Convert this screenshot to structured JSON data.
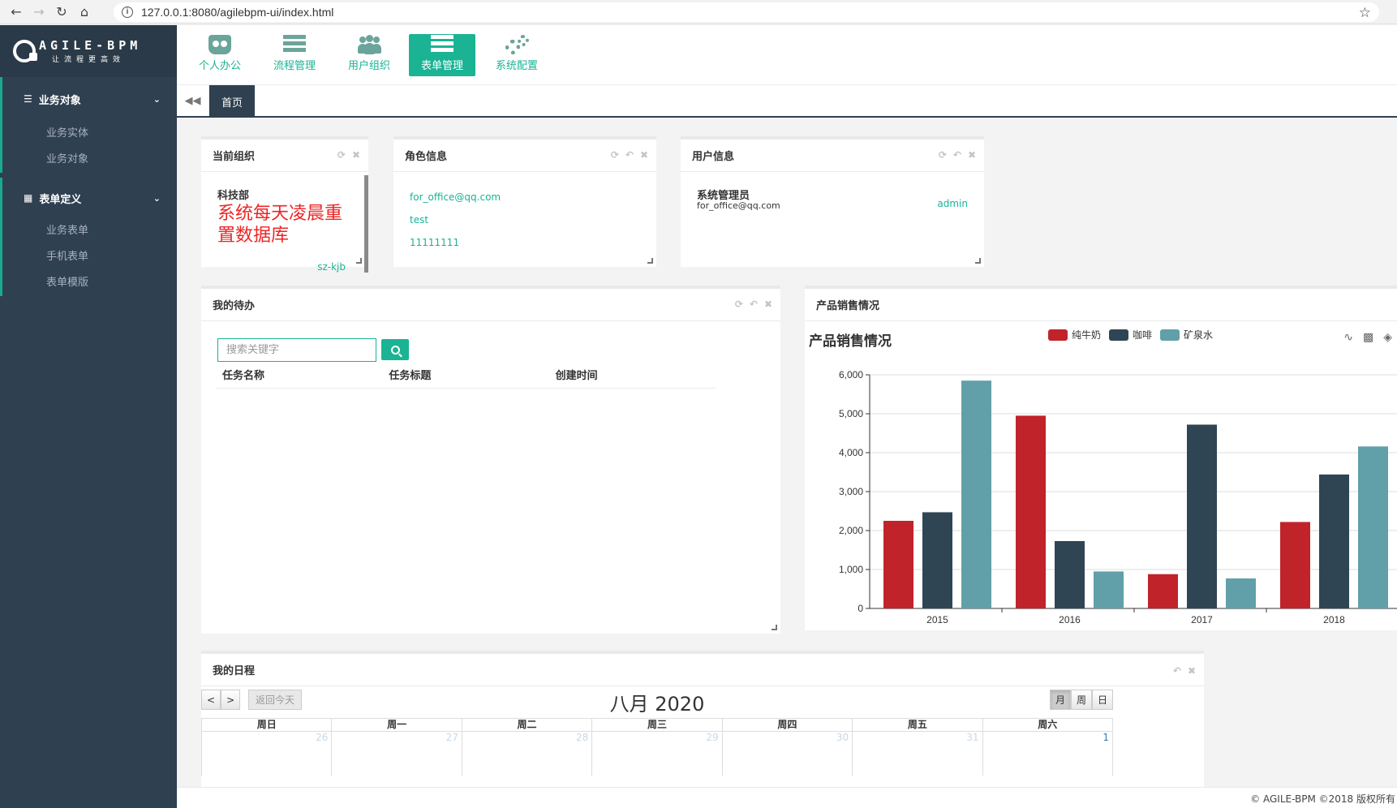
{
  "browser": {
    "url": "127.0.0.1:8080/agilebpm-ui/index.html"
  },
  "sidebar": {
    "logo_text": "AGILE-BPM",
    "logo_sub": "让流程更高效",
    "groups": [
      {
        "label": "业务对象",
        "items": [
          "业务实体",
          "业务对象"
        ]
      },
      {
        "label": "表单定义",
        "items": [
          "业务表单",
          "手机表单",
          "表单模版"
        ]
      }
    ]
  },
  "topbar": {
    "modules": [
      {
        "label": "个人办公",
        "icon": "person-card-icon",
        "active": false
      },
      {
        "label": "流程管理",
        "icon": "server-list-icon",
        "active": false
      },
      {
        "label": "用户组织",
        "icon": "users-group-icon",
        "active": false
      },
      {
        "label": "表单管理",
        "icon": "form-list-icon",
        "active": true
      },
      {
        "label": "系统配置",
        "icon": "gears-icon",
        "active": false
      }
    ]
  },
  "tabs": {
    "home": "首页"
  },
  "org_widget": {
    "title": "当前组织",
    "org_name": "科技部",
    "notice": "系统每天凌晨重置数据库",
    "code": "sz-kjb"
  },
  "role_widget": {
    "title": "角色信息",
    "lines": [
      "for_office@qq.com",
      "test",
      "11111111"
    ]
  },
  "user_widget": {
    "title": "用户信息",
    "name": "系统管理员",
    "email": "for_office@qq.com",
    "account": "admin"
  },
  "todo_widget": {
    "title": "我的待办",
    "search_placeholder": "搜索关键字",
    "columns": [
      "任务名称",
      "任务标题",
      "创建时间"
    ]
  },
  "chart_widget": {
    "title": "产品销售情况"
  },
  "chart_data": {
    "type": "bar",
    "title": "产品销售情况",
    "categories": [
      "2015",
      "2016",
      "2017",
      "2018"
    ],
    "series": [
      {
        "name": "纯牛奶",
        "color": "#c1232b",
        "values": [
          2250,
          4950,
          880,
          2220
        ]
      },
      {
        "name": "咖啡",
        "color": "#2f4554",
        "values": [
          2470,
          1730,
          4720,
          3440
        ]
      },
      {
        "name": "矿泉水",
        "color": "#61a0a8",
        "values": [
          5850,
          950,
          770,
          4160
        ]
      }
    ],
    "ylim": [
      0,
      6000
    ],
    "yticks": [
      "0",
      "1,000",
      "2,000",
      "3,000",
      "4,000",
      "5,000",
      "6,000"
    ],
    "legend": "top",
    "grid": true
  },
  "calendar_widget": {
    "title": "我的日程",
    "prev": "<",
    "next": ">",
    "today": "返回今天",
    "month_title": "八月 2020",
    "views": [
      "月",
      "周",
      "日"
    ],
    "weekdays": [
      "周日",
      "周一",
      "周二",
      "周三",
      "周四",
      "周五",
      "周六"
    ],
    "first_row": [
      "26",
      "27",
      "28",
      "29",
      "30",
      "31",
      "1"
    ]
  },
  "footer": {
    "text": "© AGILE-BPM ©2018 版权所有"
  }
}
